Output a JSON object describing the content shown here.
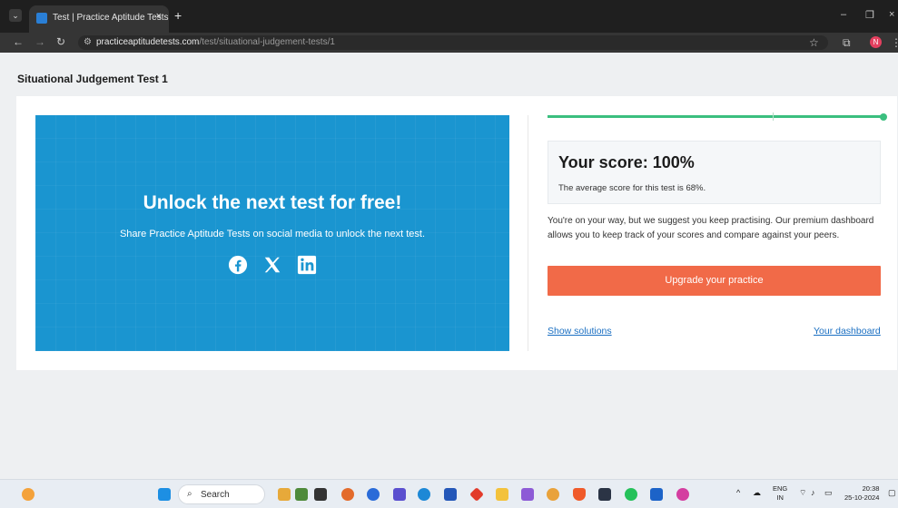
{
  "browser": {
    "tab_title": "Test | Practice Aptitude Tests",
    "tab_close": "×",
    "new_tab": "+",
    "url_domain": "practiceaptitudetests.com",
    "url_path": "/test/situational-judgement-tests/1",
    "profile_initial": "N",
    "window_controls": [
      "–",
      "❐",
      "×"
    ]
  },
  "page": {
    "title": "Situational Judgement Test 1"
  },
  "promo": {
    "heading": "Unlock the next test for free!",
    "subtext": "Share Practice Aptitude Tests on social media to unlock the next test.",
    "socials": [
      "facebook-icon",
      "x-icon",
      "linkedin-icon"
    ],
    "bg_color": "#1a95d0"
  },
  "progress": {
    "fraction": 1.0,
    "color": "#3bbf7f"
  },
  "results": {
    "score_title": "Your score: 100%",
    "average_text": "The average score for this test is 68%.",
    "advice_text": "You're on your way, but we suggest you keep practising. Our premium dashboard allows you to keep track of your scores and compare against your peers.",
    "upgrade_label": "Upgrade your practice",
    "upgrade_color": "#f16a48",
    "show_solutions": "Show solutions",
    "your_dashboard": "Your dashboard"
  },
  "taskbar": {
    "search_label": "Search",
    "lang_line1": "ENG",
    "lang_line2": "IN",
    "time": "20:38",
    "date": "25-10-2024"
  }
}
